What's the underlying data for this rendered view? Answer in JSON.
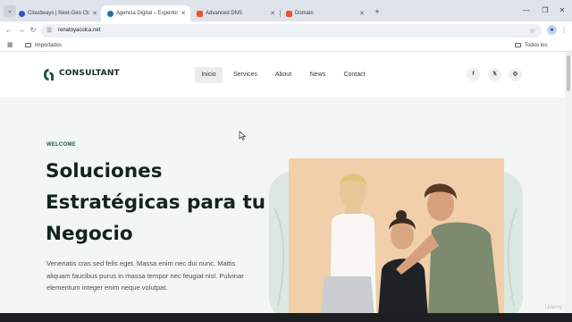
{
  "browser": {
    "tabs": [
      {
        "title": "Cloudways | Next-Gen Cloud H",
        "favicon_color": "#2e55c9",
        "active": false
      },
      {
        "title": "Agencia Digital – Expertos en",
        "favicon_color": "#21759b",
        "active": true
      },
      {
        "title": "Advanced DNS",
        "favicon_color": "#e8562a",
        "active": false
      },
      {
        "title": "Domain",
        "favicon_color": "#e8562a",
        "active": false
      }
    ],
    "url": "renatoyacolca.net",
    "bookmarks": {
      "imported": "Importados",
      "all_bookmarks": "Todos los marcadores"
    }
  },
  "site": {
    "brand": "CONSULTANT",
    "brand_color": "#1e5a3d",
    "nav": [
      "Inicio",
      "Services",
      "About",
      "News",
      "Contact"
    ],
    "active_nav": "Inicio",
    "social_icons": [
      "facebook-icon",
      "x-icon",
      "instagram-icon"
    ],
    "hero": {
      "eyebrow": "WELCOME",
      "title_lines": [
        "Soluciones",
        "Estratégicas para tu",
        "Negocio"
      ],
      "text": "Venenatis cras sed felis eget. Massa enim nec dui nunc. Mattis aliquam faucibus purus in massa tempor nec feugiat nisl. Pulvinar elementum integer enim neque volutpat."
    }
  },
  "watermark": "Udemy"
}
